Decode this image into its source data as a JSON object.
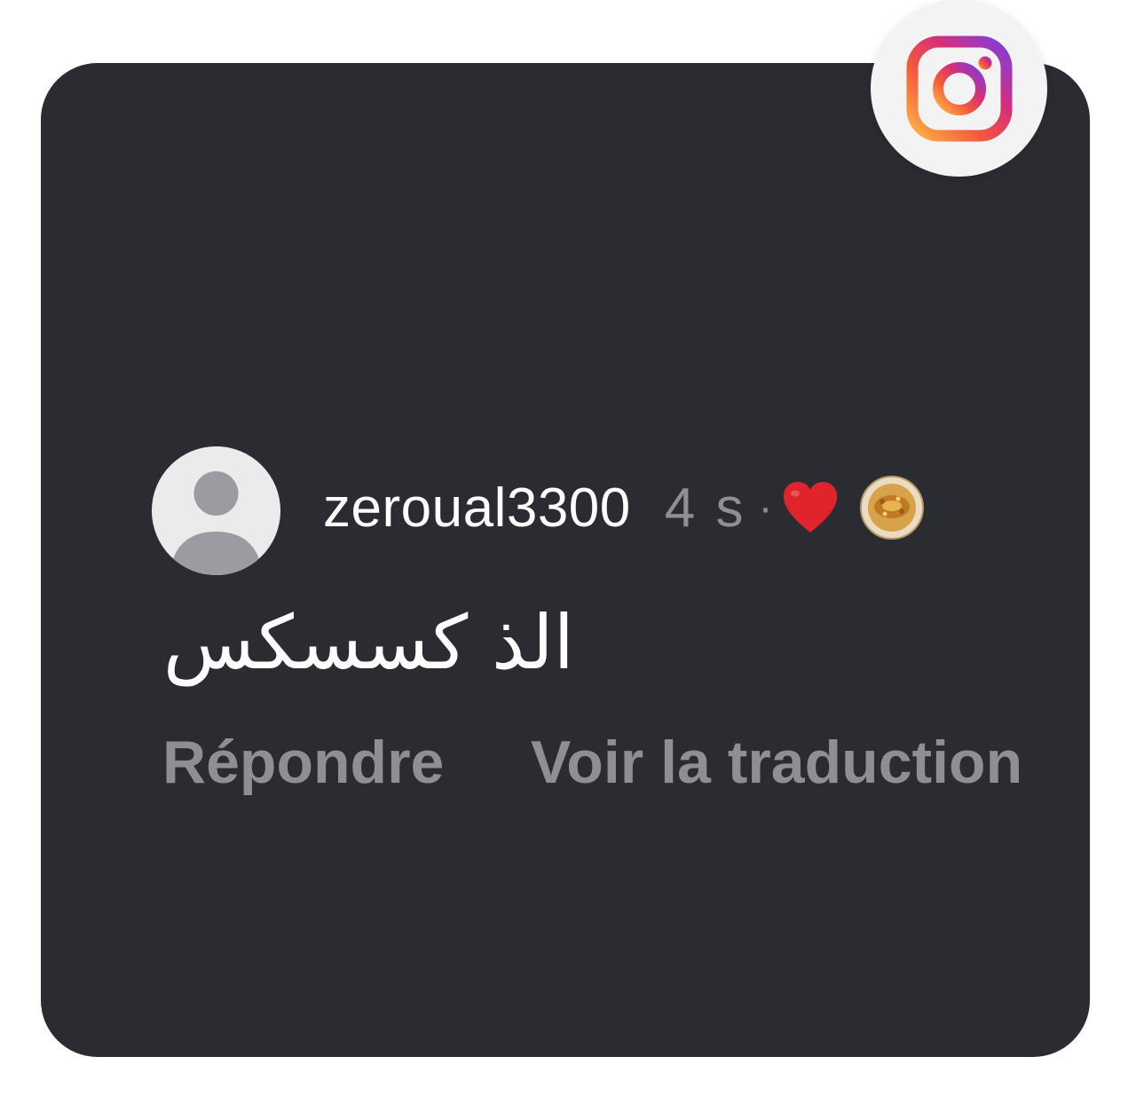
{
  "comment": {
    "username": "zeroual3300",
    "timestamp": "4 s",
    "separator": "·",
    "reaction_icons": [
      "heart-icon",
      "couscous-icon"
    ],
    "text": "الذ كسسكس"
  },
  "actions": {
    "reply_label": "Répondre",
    "translate_label": "Voir la traduction"
  },
  "icons": {
    "badge": "instagram-logo-icon",
    "avatar": "default-user-avatar-icon"
  },
  "colors": {
    "card_background": "#2b2c31",
    "page_background": "#ffffff",
    "username": "#ffffff",
    "secondary_text": "#8e8e93",
    "heart": "#e0242c"
  }
}
